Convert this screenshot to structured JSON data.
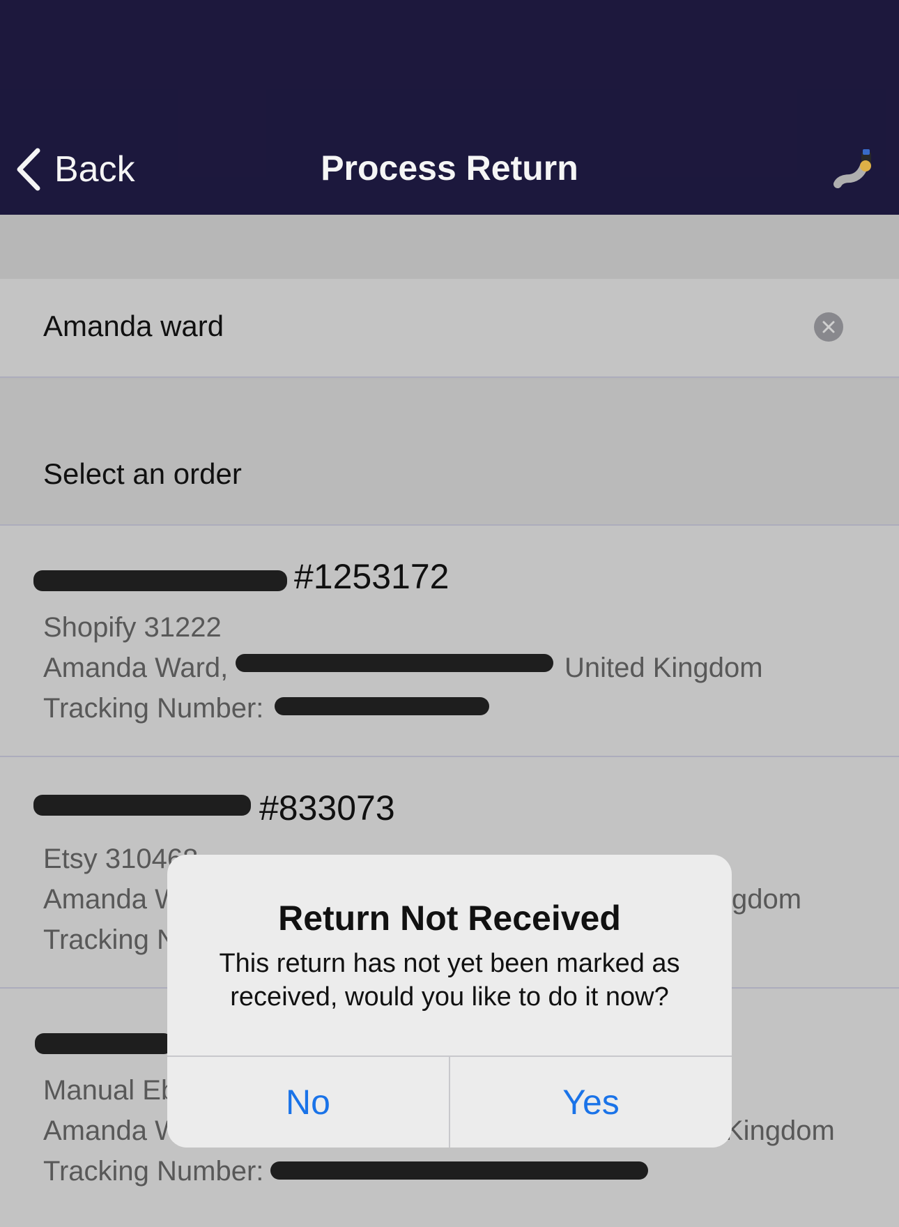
{
  "nav": {
    "back_label": "Back",
    "title": "Process Return",
    "right_icon": "phone-arm-icon"
  },
  "search": {
    "value": "Amanda ward",
    "clear_icon": "clear-circle-icon"
  },
  "section": {
    "label": "Select an order"
  },
  "orders": [
    {
      "title": "#1253172",
      "source": "Shopify 31222",
      "address_prefix": "Amanda Ward,",
      "address_suffix": "United Kingdom",
      "tracking_label": "Tracking Number:"
    },
    {
      "title": "#833073",
      "source": "Etsy 310468",
      "address_prefix": "Amanda W",
      "address_suffix": "gdom",
      "tracking_label": "Tracking N"
    },
    {
      "title": "",
      "source": "Manual Eb",
      "address_prefix": "Amanda W",
      "address_suffix": "Kingdom",
      "tracking_label": "Tracking Number:"
    }
  ],
  "alert": {
    "title": "Return Not Received",
    "message": "This return has not yet been marked as received, would you like to do it now?",
    "no_label": "No",
    "yes_label": "Yes"
  },
  "colors": {
    "navbar": "#1e1940",
    "accent": "#1a73e8",
    "redaction": "#202020"
  }
}
